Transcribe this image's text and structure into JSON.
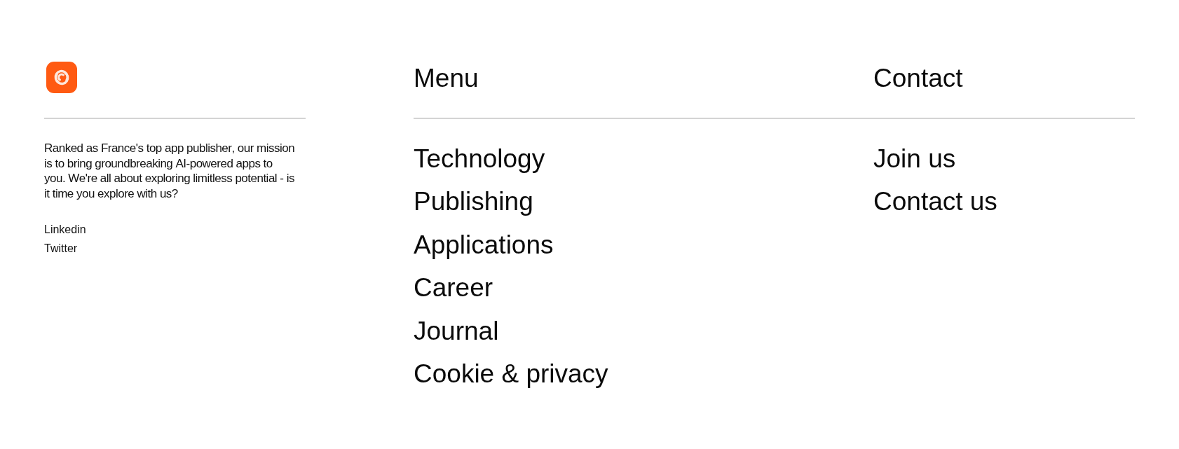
{
  "brand": {
    "description": "Ranked as France's top app publisher, our mission is to bring groundbreaking AI-powered apps to you. We're all about exploring limitless potential - is it time you explore with us?",
    "social_links": [
      "Linkedin",
      "Twitter"
    ]
  },
  "menu": {
    "title": "Menu",
    "items": [
      "Technology",
      "Publishing",
      "Applications",
      "Career",
      "Journal",
      "Cookie & privacy"
    ]
  },
  "contact": {
    "title": "Contact",
    "items": [
      "Join us",
      "Contact us"
    ]
  }
}
